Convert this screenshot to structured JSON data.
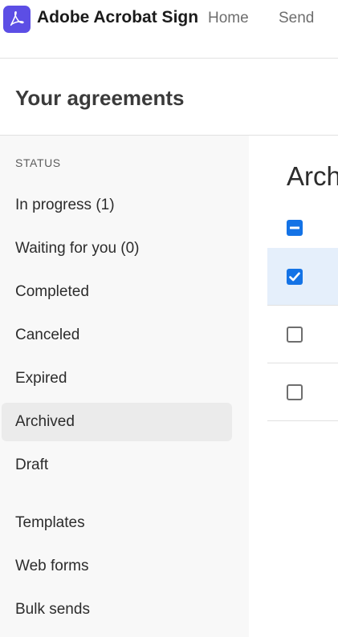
{
  "app": {
    "brand": "Adobe Acrobat Sign",
    "logo_icon": "acrobat-logo-icon",
    "accent_color": "#5c4ee5"
  },
  "nav": {
    "home": "Home",
    "send": "Send"
  },
  "page": {
    "title": "Your agreements"
  },
  "sidebar": {
    "status_label": "STATUS",
    "items": [
      {
        "label": "In progress (1)"
      },
      {
        "label": "Waiting for you (0)"
      },
      {
        "label": "Completed"
      },
      {
        "label": "Canceled"
      },
      {
        "label": "Expired"
      },
      {
        "label": "Archived",
        "active": true
      },
      {
        "label": "Draft"
      },
      {
        "label": "Templates"
      },
      {
        "label": "Web forms"
      },
      {
        "label": "Bulk sends"
      }
    ]
  },
  "main": {
    "title": "Arch",
    "select_all_state": "indeterminate",
    "rows": [
      {
        "checked": true
      },
      {
        "checked": false
      },
      {
        "checked": false
      }
    ],
    "checkbox_color": "#1473e6"
  }
}
